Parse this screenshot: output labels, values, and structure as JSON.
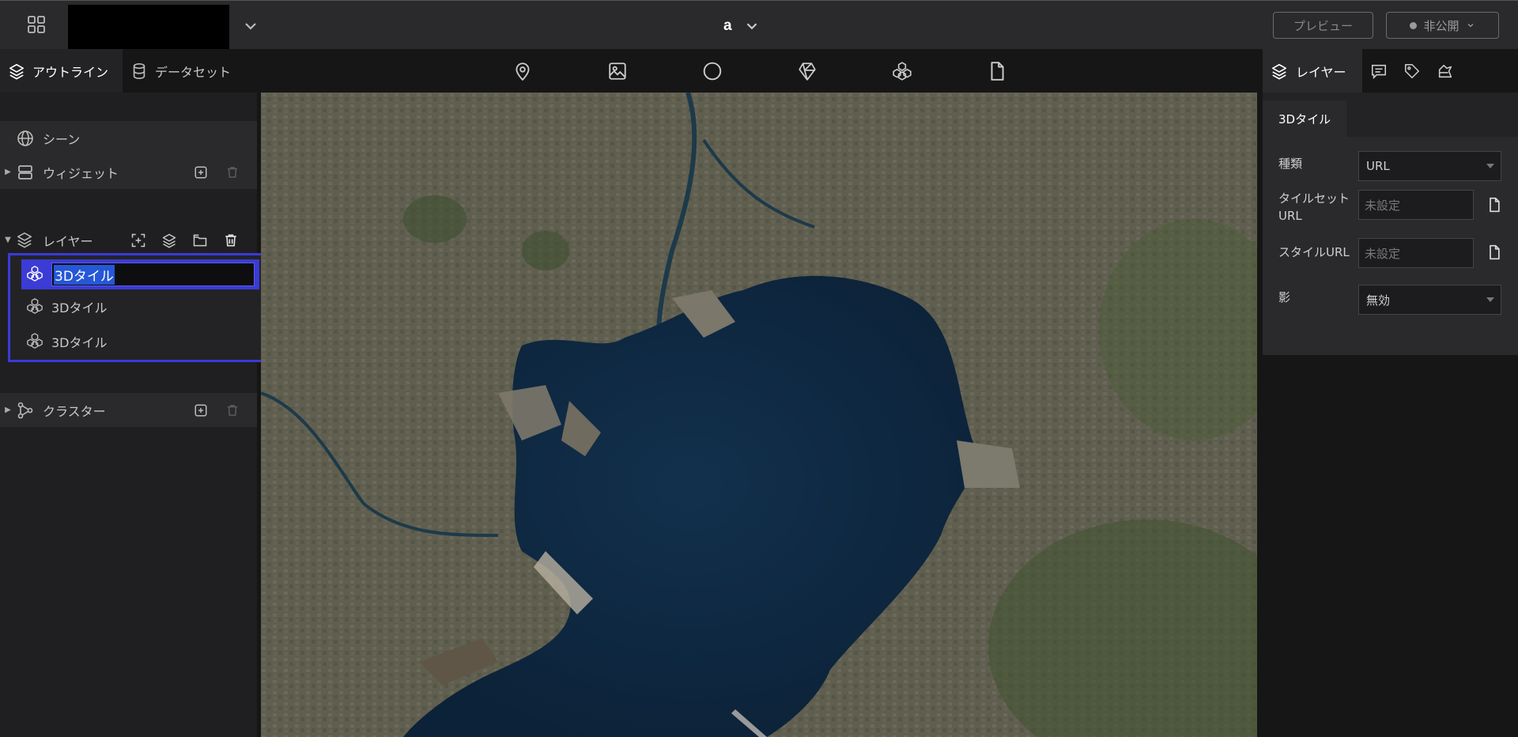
{
  "header": {
    "scene_name": "a",
    "preview_label": "プレビュー",
    "publish_label": "非公開"
  },
  "left_panel": {
    "tabs": [
      {
        "label": "アウトライン",
        "icon": "layers-icon",
        "active": true
      },
      {
        "label": "データセット",
        "icon": "database-icon",
        "active": false
      }
    ],
    "scene_label": "シーン",
    "widget_label": "ウィジェット",
    "layers_label": "レイヤー",
    "layers": [
      {
        "label": "3Dタイル",
        "selected": true,
        "editing": true
      },
      {
        "label": "3Dタイル",
        "selected": false,
        "editing": false
      },
      {
        "label": "3Dタイル",
        "selected": false,
        "editing": false
      }
    ],
    "cluster_label": "クラスター"
  },
  "toolbar": {
    "tools": [
      "marker-icon",
      "image-icon",
      "sphere-icon",
      "polygon-3d-icon",
      "3d-tiles-icon",
      "file-icon"
    ]
  },
  "right_panel": {
    "tabs": [
      {
        "label": "レイヤー",
        "icon": "layers-icon",
        "active": true
      },
      {
        "label": "",
        "icon": "infobox-icon"
      },
      {
        "label": "",
        "icon": "tag-icon"
      },
      {
        "label": "",
        "icon": "style-icon"
      }
    ],
    "subtab": "3Dタイル",
    "fields": {
      "type_label": "種類",
      "type_value": "URL",
      "tileset_label_line1": "タイルセット",
      "tileset_label_line2": "URL",
      "tileset_placeholder": "未設定",
      "style_label": "スタイルURL",
      "style_placeholder": "未設定",
      "shadow_label": "影",
      "shadow_value": "無効"
    }
  },
  "colors": {
    "accent": "#3b3bd6",
    "selection_border": "#3a3ad9",
    "header_bg": "#2a2a2c",
    "panel_bg": "#1f1f21",
    "water": "#0f2a45"
  }
}
